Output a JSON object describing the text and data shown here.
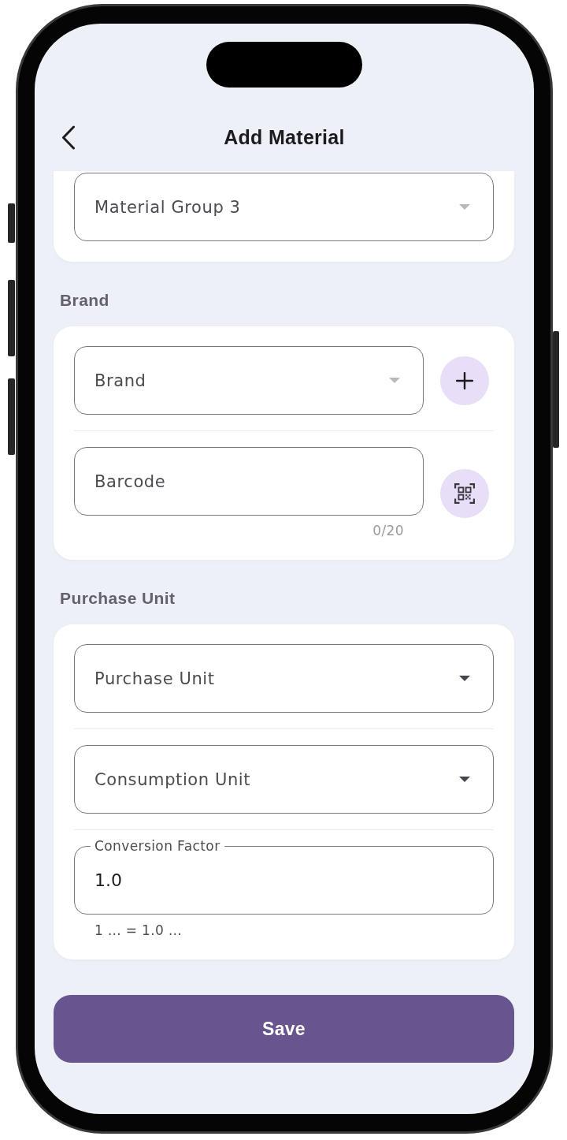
{
  "header": {
    "title": "Add Material"
  },
  "sections": [
    {
      "fields": [
        {
          "kind": "dropdown",
          "value": "Material Group 3",
          "disabled": true
        }
      ]
    },
    {
      "label": "Brand",
      "fields": [
        {
          "kind": "dropdown",
          "placeholder": "Brand",
          "disabled": true,
          "trailing_button": {
            "kind": "add"
          }
        },
        {
          "kind": "text",
          "placeholder": "Barcode",
          "counter": "0/20",
          "trailing_button": {
            "kind": "scan"
          }
        }
      ]
    },
    {
      "label": "Purchase Unit",
      "fields": [
        {
          "kind": "dropdown",
          "placeholder": "Purchase Unit",
          "disabled": false
        },
        {
          "kind": "dropdown",
          "placeholder": "Consumption Unit",
          "disabled": false
        },
        {
          "kind": "text",
          "label": "Conversion Factor",
          "value": "1.0",
          "helper": "1 … = 1.0 …"
        }
      ]
    }
  ],
  "save_button": {
    "label": "Save"
  }
}
